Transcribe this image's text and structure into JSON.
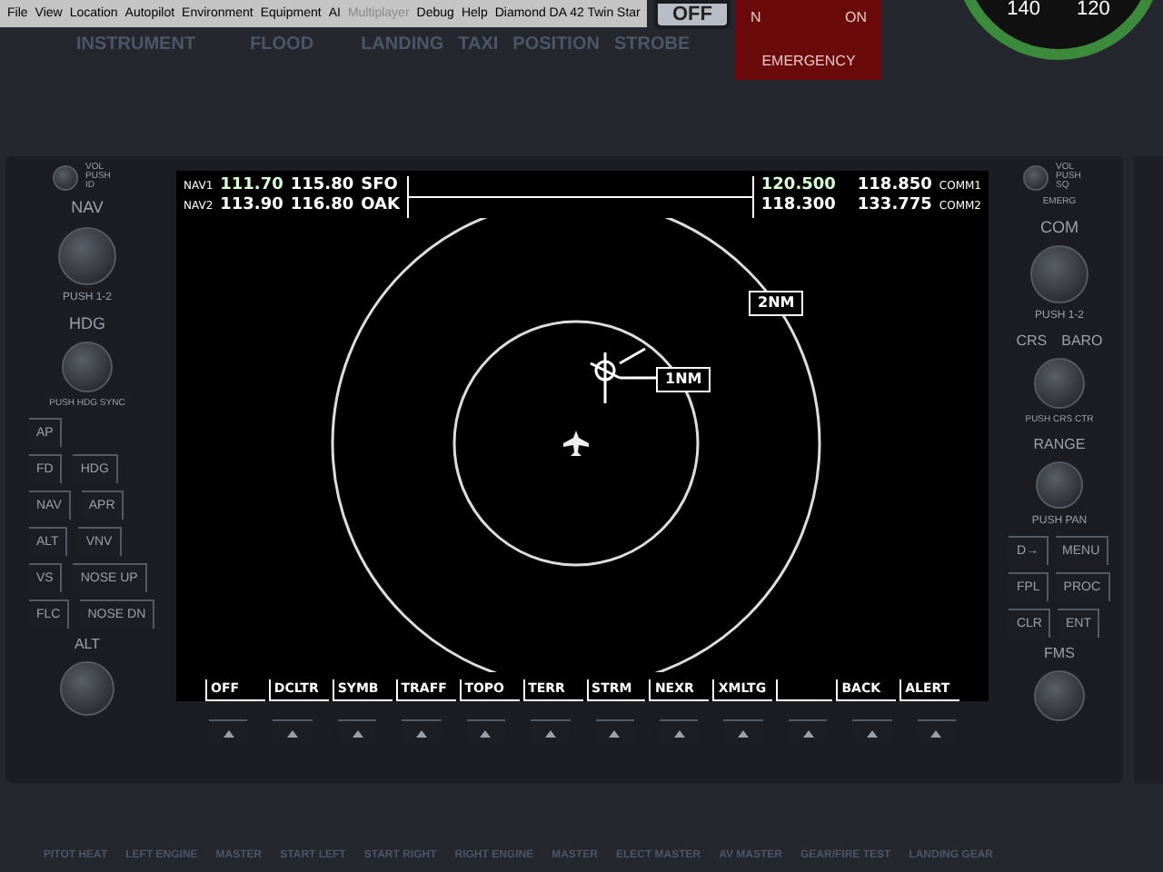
{
  "menu_bar": {
    "items": [
      {
        "label": "File",
        "disabled": false
      },
      {
        "label": "View",
        "disabled": false
      },
      {
        "label": "Location",
        "disabled": false
      },
      {
        "label": "Autopilot",
        "disabled": false
      },
      {
        "label": "Environment",
        "disabled": false
      },
      {
        "label": "Equipment",
        "disabled": false
      },
      {
        "label": "AI",
        "disabled": false
      },
      {
        "label": "Multiplayer",
        "disabled": true
      },
      {
        "label": "Debug",
        "disabled": false
      },
      {
        "label": "Help",
        "disabled": false
      }
    ],
    "aircraft": "Diamond DA 42 Twin Star"
  },
  "top_panel": {
    "labels": [
      "INSTRUMENT",
      "FLOOD",
      "LANDING",
      "TAXI",
      "POSITION",
      "STROBE"
    ],
    "strobe_switch": {
      "label": "OFF",
      "on": false
    },
    "emergency": {
      "left": "N",
      "right": "ON",
      "title": "EMERGENCY"
    },
    "airspeed_ticks": [
      "140",
      "120"
    ]
  },
  "left_bezel": {
    "vol_label": "VOL PUSH ID",
    "nav_label": "NAV",
    "nav_push": "PUSH 1-2",
    "hdg_label": "HDG",
    "hdg_push": "PUSH HDG SYNC",
    "button_rows": [
      [
        "AP"
      ],
      [
        "FD",
        "HDG"
      ],
      [
        "NAV",
        "APR"
      ],
      [
        "ALT",
        "VNV"
      ],
      [
        "VS",
        "NOSE UP"
      ],
      [
        "FLC",
        "NOSE DN"
      ]
    ],
    "alt_label": "ALT"
  },
  "display": {
    "nav": [
      {
        "label": "NAV1",
        "active": "111.70",
        "standby": "115.80",
        "ident": "SFO",
        "selected": true
      },
      {
        "label": "NAV2",
        "active": "113.90",
        "standby": "116.80",
        "ident": "OAK",
        "selected": false
      }
    ],
    "com": [
      {
        "label": "COMM1",
        "active": "120.500",
        "standby": "118.850",
        "selected": true
      },
      {
        "label": "COMM2",
        "active": "118.300",
        "standby": "133.775",
        "selected": false
      }
    ],
    "map": {
      "outer_range": "2NM",
      "inner_range": "1NM"
    },
    "softkeys": [
      {
        "kind": "labeled",
        "label": "OFF"
      },
      {
        "kind": "labeled",
        "label": "DCLTR"
      },
      {
        "kind": "labeled",
        "label": "SYMB"
      },
      {
        "kind": "labeled",
        "label": "TRAFF"
      },
      {
        "kind": "labeled",
        "label": "TOPO"
      },
      {
        "kind": "labeled",
        "label": "TERR"
      },
      {
        "kind": "labeled",
        "label": "STRM"
      },
      {
        "kind": "labeled",
        "label": "NEXR"
      },
      {
        "kind": "labeled",
        "label": "XMLTG"
      },
      {
        "kind": "blank"
      },
      {
        "kind": "labeled",
        "label": "BACK"
      },
      {
        "kind": "labeled",
        "label": "ALERT"
      }
    ]
  },
  "right_bezel": {
    "vol_label": "VOL PUSH SQ",
    "emerg_label": "EMERG",
    "com_label": "COM",
    "com_push": "PUSH 1-2",
    "crs_label": "CRS",
    "baro_label": "BARO",
    "crs_push": "PUSH CRS CTR",
    "range_label": "RANGE",
    "range_push": "PUSH PAN",
    "button_rows": [
      [
        "D→",
        "MENU"
      ],
      [
        "FPL",
        "PROC"
      ],
      [
        "CLR",
        "ENT"
      ]
    ],
    "fms_label": "FMS"
  },
  "bottom_panel": {
    "labels": [
      "PITOT HEAT",
      "LEFT ENGINE",
      "MASTER",
      "START LEFT",
      "START RIGHT",
      "RIGHT ENGINE",
      "MASTER",
      "ELECT MASTER",
      "AV MASTER",
      "GEAR/FIRE TEST",
      "LANDING GEAR"
    ]
  }
}
